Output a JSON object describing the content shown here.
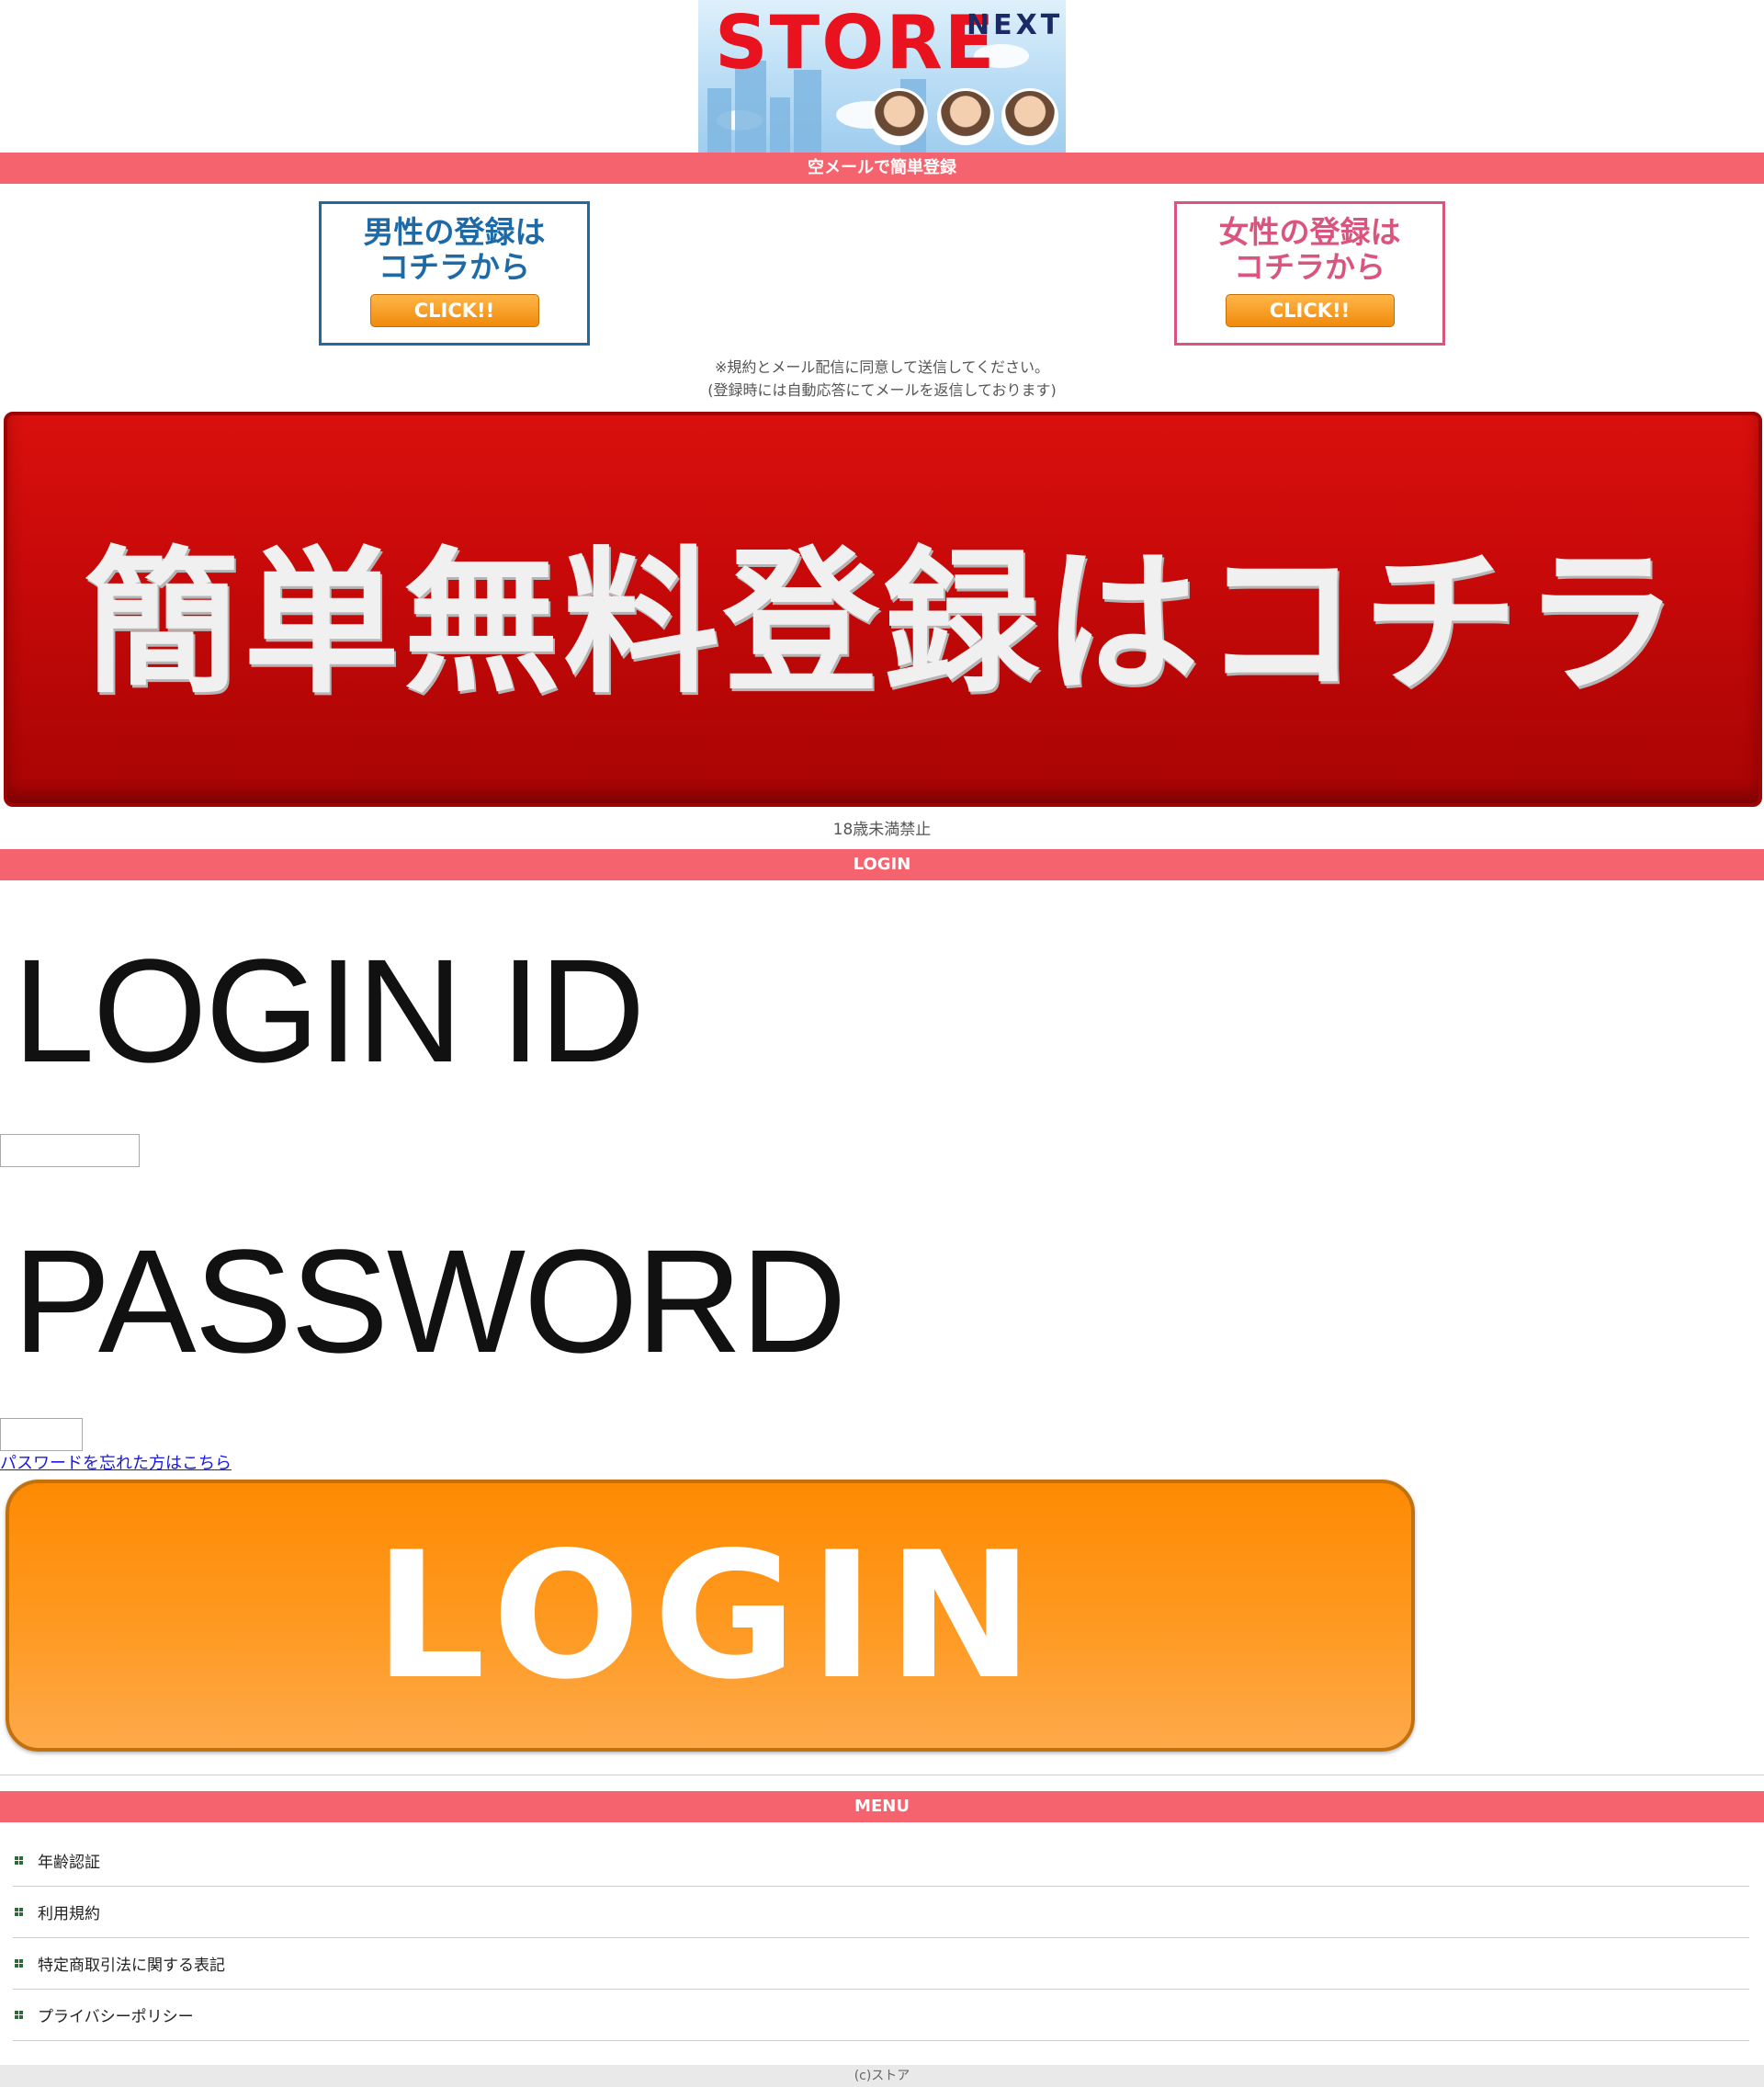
{
  "header": {
    "logo_main": "STORE",
    "logo_sub": "NEXT"
  },
  "sections": {
    "register_bar": "空メールで簡単登録",
    "login_bar": "LOGIN",
    "menu_bar": "MENU"
  },
  "register": {
    "male": {
      "line1": "男性の登録は",
      "line2": "コチラから",
      "button": "CLICK!!"
    },
    "female": {
      "line1": "女性の登録は",
      "line2": "コチラから",
      "button": "CLICK!!"
    },
    "note_line1": "※規約とメール配信に同意して送信してください。",
    "note_line2": "(登録時には自動応答にてメールを返信しております)",
    "banner": "簡単無料登録はコチラ",
    "age_notice": "18歳未満禁止"
  },
  "login": {
    "id_label": "LOGIN ID",
    "password_label": "PASSWORD",
    "id_value": "",
    "password_value": "",
    "forgot_link": "パスワードを忘れた方はこちら",
    "button": "LOGIN"
  },
  "menu": {
    "items": [
      {
        "label": "年齢認証"
      },
      {
        "label": "利用規約"
      },
      {
        "label": "特定商取引法に関する表記"
      },
      {
        "label": "プライバシーポリシー"
      }
    ]
  },
  "footer": {
    "copyright": "(c)ストア"
  },
  "colors": {
    "section_bar": "#f5636e",
    "male": "#1e6aa6",
    "female": "#d9557e",
    "red_banner": "#c80909",
    "login_button": "#fe8a03"
  }
}
